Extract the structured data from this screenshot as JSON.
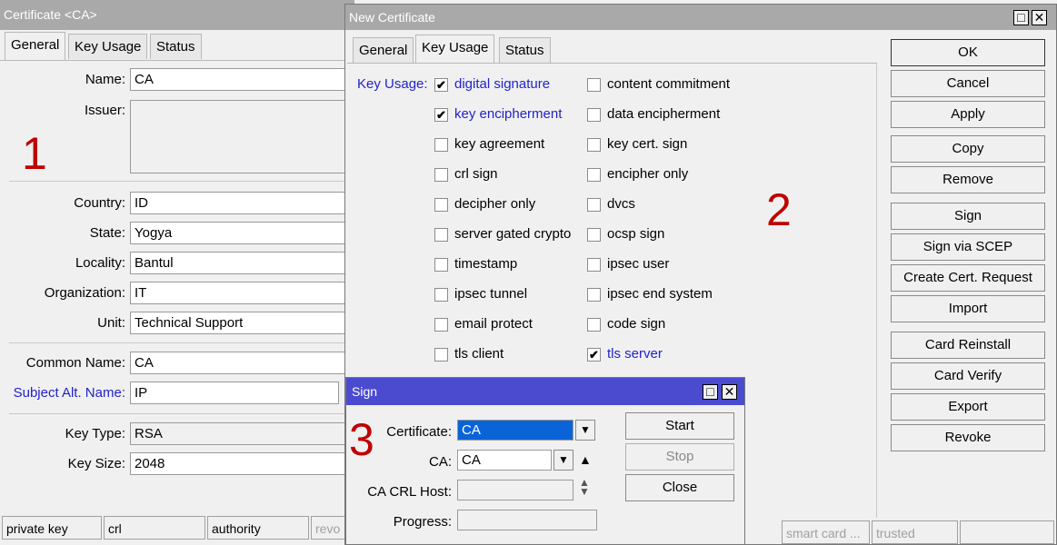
{
  "annotations": {
    "one": "1",
    "two": "2",
    "three": "3"
  },
  "cert_window": {
    "title": "Certificate <CA>",
    "tabs": [
      "General",
      "Key Usage",
      "Status"
    ],
    "labels": {
      "name": "Name:",
      "issuer": "Issuer:",
      "country": "Country:",
      "state": "State:",
      "locality": "Locality:",
      "organization": "Organization:",
      "unit": "Unit:",
      "common_name": "Common Name:",
      "subject_alt_name": "Subject Alt. Name:",
      "key_type": "Key Type:",
      "key_size": "Key Size:"
    },
    "values": {
      "name": "CA",
      "issuer": "",
      "country": "ID",
      "state": "Yogya",
      "locality": "Bantul",
      "organization": "IT",
      "unit": "Technical Support",
      "common_name": "CA",
      "subject_alt_name": "IP",
      "key_type": "RSA",
      "key_size": "2048"
    },
    "status_bar": [
      "private key",
      "crl",
      "authority",
      "revo"
    ]
  },
  "new_cert_window": {
    "title": "New Certificate",
    "tabs": [
      "General",
      "Key Usage",
      "Status"
    ],
    "key_usage_label": "Key Usage:",
    "key_usages_left": [
      {
        "label": "digital signature",
        "checked": true
      },
      {
        "label": "key encipherment",
        "checked": true
      },
      {
        "label": "key agreement",
        "checked": false
      },
      {
        "label": "crl sign",
        "checked": false
      },
      {
        "label": "decipher only",
        "checked": false
      },
      {
        "label": "server gated crypto",
        "checked": false
      },
      {
        "label": "timestamp",
        "checked": false
      },
      {
        "label": "ipsec tunnel",
        "checked": false
      },
      {
        "label": "email protect",
        "checked": false
      },
      {
        "label": "tls client",
        "checked": false
      }
    ],
    "key_usages_right": [
      {
        "label": "content commitment",
        "checked": false
      },
      {
        "label": "data encipherment",
        "checked": false
      },
      {
        "label": "key cert. sign",
        "checked": false
      },
      {
        "label": "encipher only",
        "checked": false
      },
      {
        "label": "dvcs",
        "checked": false
      },
      {
        "label": "ocsp sign",
        "checked": false
      },
      {
        "label": "ipsec user",
        "checked": false
      },
      {
        "label": "ipsec end system",
        "checked": false
      },
      {
        "label": "code sign",
        "checked": false
      },
      {
        "label": "tls server",
        "checked": true
      }
    ],
    "buttons": [
      "OK",
      "Cancel",
      "Apply",
      "Copy",
      "Remove",
      "Sign",
      "Sign via SCEP",
      "Create Cert. Request",
      "Import",
      "Card Reinstall",
      "Card Verify",
      "Export",
      "Revoke"
    ],
    "status_bar": [
      "smart card ...",
      "trusted",
      ""
    ]
  },
  "sign_dialog": {
    "title": "Sign",
    "labels": {
      "certificate": "Certificate:",
      "ca": "CA:",
      "ca_crl_host": "CA CRL Host:",
      "progress": "Progress:"
    },
    "values": {
      "certificate": "CA",
      "ca": "CA",
      "ca_crl_host": "",
      "progress": ""
    },
    "buttons": {
      "start": "Start",
      "stop": "Stop",
      "close": "Close"
    }
  },
  "colors": {
    "sign_titlebar": "#4b4bd0",
    "selected_field": "#0a64d8",
    "link_blue": "#2222cc",
    "annotation_red": "#c00000"
  }
}
